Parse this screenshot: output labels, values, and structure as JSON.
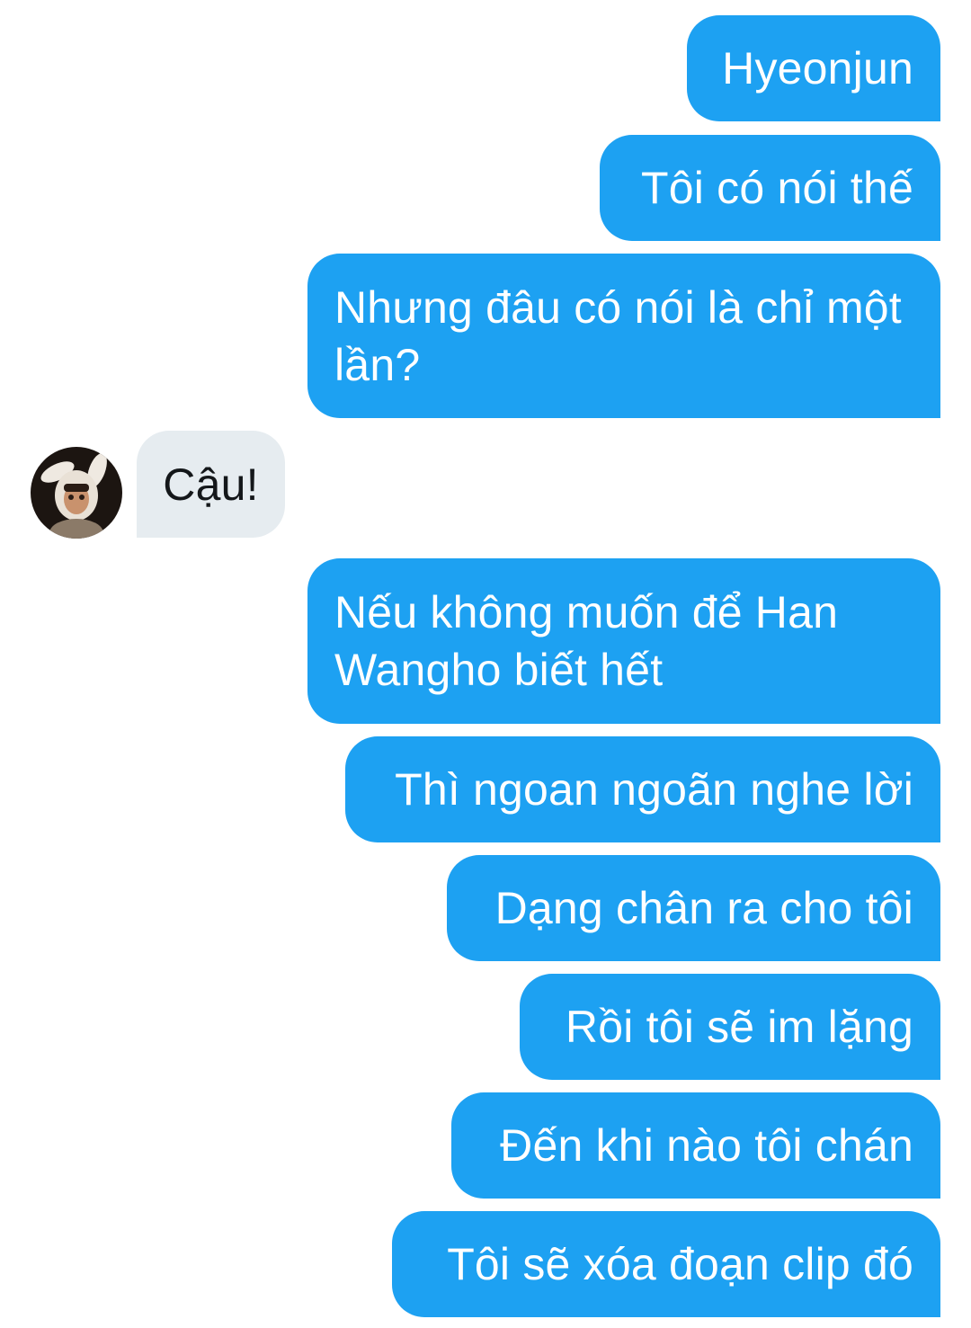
{
  "conversation": {
    "messages": [
      {
        "sender": "me",
        "text": "Hyeonjun"
      },
      {
        "sender": "me",
        "text": "Tôi có nói thế"
      },
      {
        "sender": "me",
        "text": "Nhưng đâu có nói là chỉ một lần?"
      },
      {
        "sender": "other",
        "text": "Cậu!"
      },
      {
        "sender": "me",
        "text": "Nếu không muốn để Han Wangho biết hết"
      },
      {
        "sender": "me",
        "text": "Thì ngoan ngoãn nghe lời"
      },
      {
        "sender": "me",
        "text": "Dạng chân ra cho tôi"
      },
      {
        "sender": "me",
        "text": "Rồi tôi sẽ im lặng"
      },
      {
        "sender": "me",
        "text": "Đến khi nào tôi chán"
      },
      {
        "sender": "me",
        "text": "Tôi sẽ xóa đoạn clip đó"
      }
    ]
  },
  "colors": {
    "sent_bubble": "#1da1f2",
    "sent_text": "#ffffff",
    "received_bubble": "#e6ecf0",
    "received_text": "#14171a"
  },
  "avatar": {
    "icon": "user-avatar-bunny-ears"
  }
}
